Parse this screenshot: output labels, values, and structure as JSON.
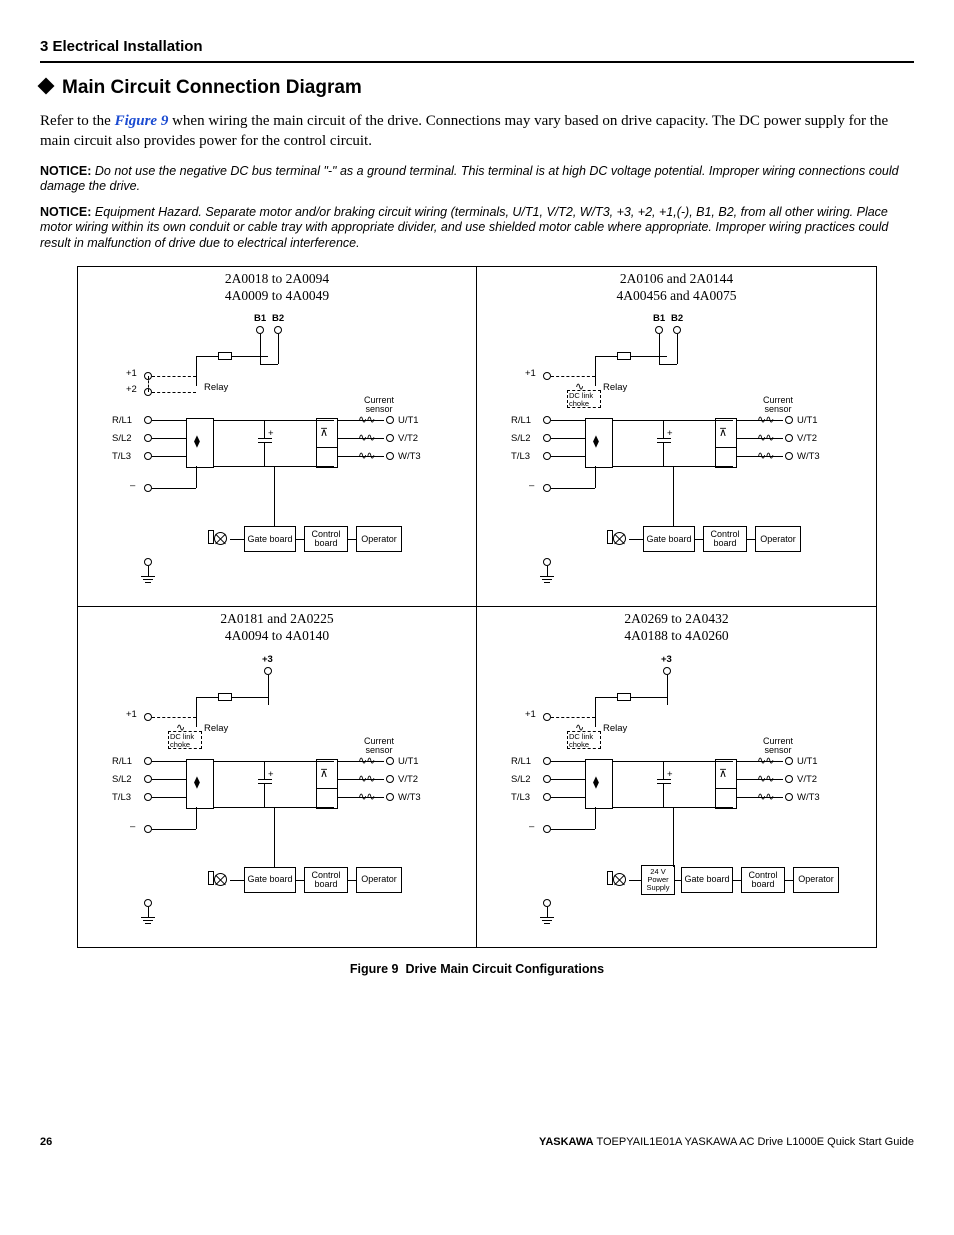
{
  "header": {
    "section": "3  Electrical Installation"
  },
  "title": "Main Circuit Connection Diagram",
  "intro": {
    "pre": "Refer to the ",
    "link": "Figure 9",
    "post": " when wiring the main circuit of the drive. Connections may vary based on drive capacity. The DC power supply for the main circuit also provides power for the control circuit."
  },
  "notice1": {
    "label": "NOTICE:",
    "text": " Do not use the negative DC bus terminal \"-\" as a ground terminal. This terminal is at high DC voltage potential. Improper wiring connections could damage the drive."
  },
  "notice2": {
    "label": "NOTICE:",
    "text": " Equipment Hazard. Separate motor and/or braking circuit wiring (terminals, U/T1, V/T2, W/T3, +3, +2, +1,(-), B1, B2, from all other wiring. Place motor wiring within its own conduit or cable tray with appropriate divider, and use shielded motor cable where appropriate. Improper wiring practices could result in malfunction of drive due to electrical interference."
  },
  "figure": {
    "caption_label": "Figure 9",
    "caption_text": "Drive Main Circuit Configurations",
    "cells": [
      {
        "models": [
          "2A0018 to 2A0094",
          "4A0009 to 4A0049"
        ],
        "top_terms": [
          "B1",
          "B2"
        ],
        "left_terms_top": [
          "+1",
          "+2"
        ],
        "relay": "Relay",
        "current_sensor": "Current\nsensor",
        "in_terms": [
          "R/L1",
          "S/L2",
          "T/L3"
        ],
        "out_terms": [
          "U/T1",
          "V/T2",
          "W/T3"
        ],
        "blocks": [
          "Gate board",
          "Control\nboard",
          "Operator"
        ],
        "dc_choke": null,
        "extra_block": null
      },
      {
        "models": [
          "2A0106 and 2A0144",
          "4A00456 and 4A0075"
        ],
        "top_terms": [
          "B1",
          "B2"
        ],
        "left_terms_top": [
          "+1"
        ],
        "relay": "Relay",
        "current_sensor": "Current\nsensor",
        "in_terms": [
          "R/L1",
          "S/L2",
          "T/L3"
        ],
        "out_terms": [
          "U/T1",
          "V/T2",
          "W/T3"
        ],
        "blocks": [
          "Gate board",
          "Control\nboard",
          "Operator"
        ],
        "dc_choke": "DC link\nchoke",
        "extra_block": null
      },
      {
        "models": [
          "2A0181 and 2A0225",
          "4A0094 to 4A0140"
        ],
        "top_terms": [
          "+3"
        ],
        "left_terms_top": [
          "+1"
        ],
        "relay": "Relay",
        "current_sensor": "Current\nsensor",
        "in_terms": [
          "R/L1",
          "S/L2",
          "T/L3"
        ],
        "out_terms": [
          "U/T1",
          "V/T2",
          "W/T3"
        ],
        "blocks": [
          "Gate board",
          "Control\nboard",
          "Operator"
        ],
        "dc_choke": "DC link\nchoke",
        "extra_block": null
      },
      {
        "models": [
          "2A0269 to 2A0432",
          "4A0188 to 4A0260"
        ],
        "top_terms": [
          "+3"
        ],
        "left_terms_top": [
          "+1"
        ],
        "relay": "Relay",
        "current_sensor": "Current\nsensor",
        "in_terms": [
          "R/L1",
          "S/L2",
          "T/L3"
        ],
        "out_terms": [
          "U/T1",
          "V/T2",
          "W/T3"
        ],
        "blocks": [
          "Gate board",
          "Control\nboard",
          "Operator"
        ],
        "dc_choke": "DC link\nchoke",
        "extra_block": "24 V\nPower\nSupply"
      }
    ]
  },
  "footer": {
    "page": "26",
    "brand": "YASKAWA",
    "doc": " TOEPYAIL1E01A YASKAWA AC Drive L1000E Quick Start Guide"
  },
  "common": {
    "minus": "–",
    "plus": "+"
  }
}
